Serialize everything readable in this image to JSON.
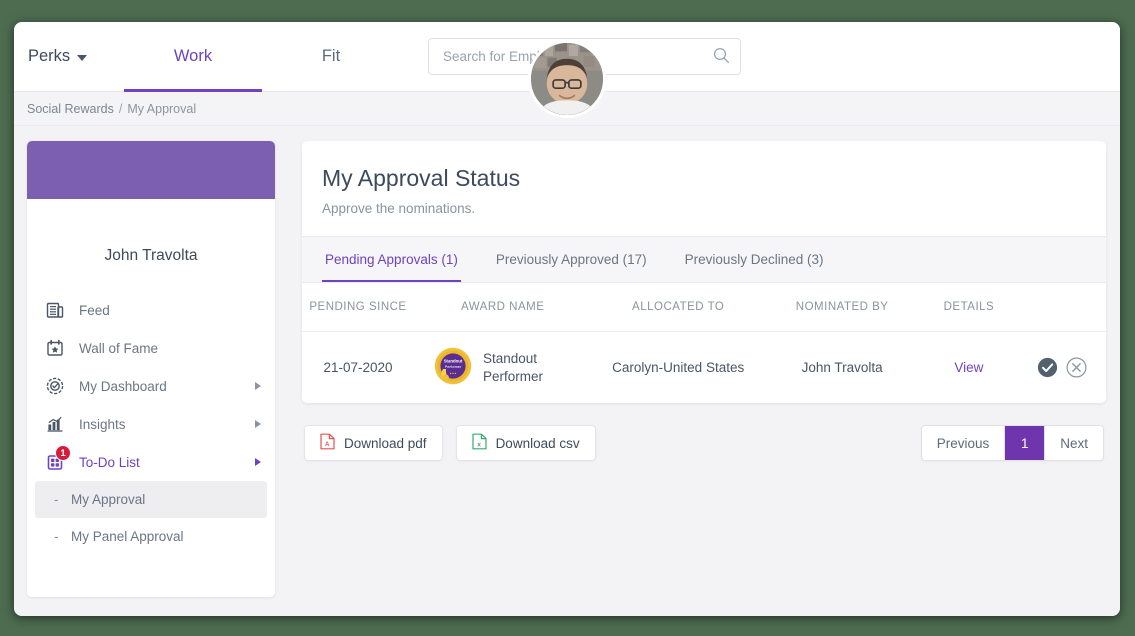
{
  "topnav": {
    "brand": "Perks",
    "brand_caret": "chevron-down",
    "tabs": [
      {
        "label": "Work",
        "active": true
      },
      {
        "label": "Fit",
        "active": false
      }
    ],
    "search": {
      "placeholder": "Search for Employees...",
      "value": "",
      "icon": "search-icon"
    }
  },
  "breadcrumb": {
    "root": "Social Rewards",
    "separator": "/",
    "current": "My Approval"
  },
  "sidebar": {
    "profile": {
      "name": "John Travolta",
      "avatar": "user-avatar"
    },
    "items": [
      {
        "label": "Feed",
        "icon": "feed-icon",
        "chevron": false,
        "badge": null
      },
      {
        "label": "Wall of Fame",
        "icon": "calendar-star-icon",
        "chevron": false,
        "badge": null
      },
      {
        "label": "My Dashboard",
        "icon": "target-icon",
        "chevron": true,
        "badge": null
      },
      {
        "label": "Insights",
        "icon": "bar-chart-icon",
        "chevron": true,
        "badge": null
      },
      {
        "label": "To-Do List",
        "icon": "todo-grid-icon",
        "chevron": true,
        "badge": "1"
      }
    ],
    "sub_items": [
      {
        "label": "My Approval",
        "selected": true
      },
      {
        "label": "My Panel Approval",
        "selected": false
      }
    ]
  },
  "main": {
    "title": "My Approval Status",
    "subtitle": "Approve the nominations.",
    "tabs": [
      {
        "label": "Pending Approvals (1)",
        "active": true
      },
      {
        "label": "Previously Approved (17)",
        "active": false
      },
      {
        "label": "Previously Declined (3)",
        "active": false
      }
    ],
    "table": {
      "columns": [
        "PENDING SINCE",
        "AWARD NAME",
        "ALLOCATED TO",
        "NOMINATED BY",
        "DETAILS",
        ""
      ],
      "rows": [
        {
          "pending_since": "21-07-2020",
          "award_badge": "standout-performer-medal",
          "award_badge_text": "Standout Performer",
          "award_name": "Standout Performer",
          "allocated_to": "Carolyn-United States",
          "nominated_by": "John Travolta",
          "details": "View",
          "approve_icon": "approve-check-icon",
          "decline_icon": "decline-cross-icon"
        }
      ]
    },
    "downloads": [
      {
        "label": "Download pdf",
        "icon": "pdf-file-icon"
      },
      {
        "label": "Download csv",
        "icon": "csv-file-icon"
      }
    ],
    "pagination": {
      "previous": "Previous",
      "page": "1",
      "next": "Next"
    }
  },
  "colors": {
    "accent_purple": "#6f42c1",
    "page_active_purple": "#6f35ad",
    "hero_purple": "#7c5fb0",
    "badge_red": "#d81b3c",
    "desktop_green": "#4d6c50",
    "pdf_red": "#e0554f",
    "csv_green": "#3aa96b",
    "approve_slate": "#53616f"
  }
}
